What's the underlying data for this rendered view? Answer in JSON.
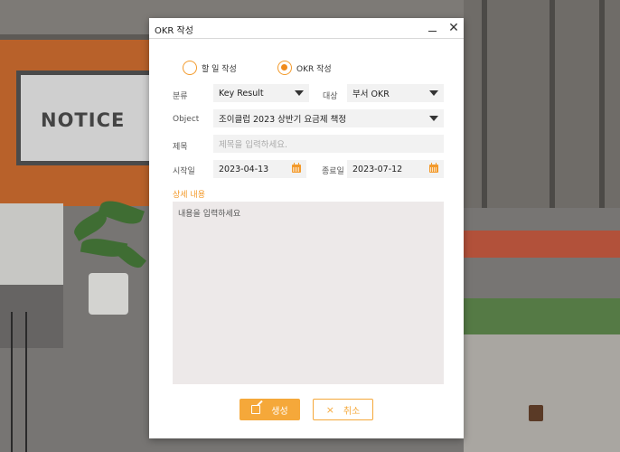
{
  "background": {
    "notice_sign": "NOTICE"
  },
  "window": {
    "title": "OKR 작성",
    "minimize_icon": "minimize-icon",
    "close_icon": "close-icon"
  },
  "mode": {
    "options": [
      {
        "label": "할 일 작성",
        "checked": false
      },
      {
        "label": "OKR 작성",
        "checked": true
      }
    ]
  },
  "form": {
    "category_label": "분류",
    "category_value": "Key Result",
    "target_label": "대상",
    "target_value": "부서 OKR",
    "object_label": "Object",
    "object_value": "조이클럽 2023 상반기 요금제 책정",
    "title_label": "제목",
    "title_placeholder": "제목을 입력하세요.",
    "start_label": "시작일",
    "start_value": "2023-04-13",
    "end_label": "종료일",
    "end_value": "2023-07-12",
    "detail_label": "상세 내용",
    "detail_placeholder": "내용을 입력하세요"
  },
  "actions": {
    "create_label": "생성",
    "cancel_label": "취소",
    "cancel_symbol": "×"
  },
  "colors": {
    "accent": "#f5a83a",
    "field_bg": "#f2f2f2",
    "textarea_bg": "#ede9e9"
  }
}
